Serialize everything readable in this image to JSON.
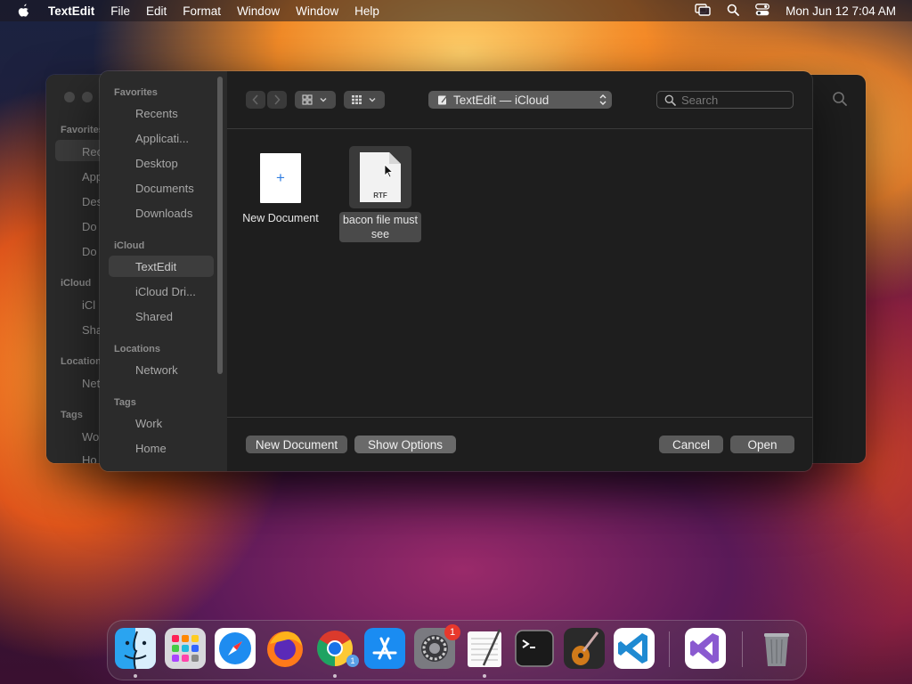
{
  "menubar": {
    "app_name": "TextEdit",
    "items": [
      "File",
      "Edit",
      "Format",
      "Window",
      "Help"
    ],
    "window_item": "Window",
    "clock": "Mon Jun 12  7:04 AM"
  },
  "bg_window": {
    "sections": [
      "Favorites",
      "iCloud",
      "Location",
      "Tags"
    ],
    "items": [
      "Rec",
      "App",
      "Des",
      "Do",
      "Do",
      "iCl",
      "Sha",
      "Net",
      "Wo",
      "Ho"
    ]
  },
  "sidebar": {
    "favorites_header": "Favorites",
    "favorites": [
      "Recents",
      "Applicati...",
      "Desktop",
      "Documents",
      "Downloads"
    ],
    "icloud_header": "iCloud",
    "icloud": [
      "TextEdit",
      "iCloud Dri...",
      "Shared"
    ],
    "locations_header": "Locations",
    "locations": [
      "Network"
    ],
    "tags_header": "Tags",
    "tags": [
      "Work",
      "Home"
    ]
  },
  "toolbar": {
    "location": "TextEdit — iCloud",
    "search_placeholder": "Search"
  },
  "files": [
    {
      "name": "New Document",
      "kind": "new"
    },
    {
      "name": "bacon file must see",
      "kind": "RTF",
      "selected": true
    }
  ],
  "file_badge": "RTF",
  "footer": {
    "new_document": "New Document",
    "show_options": "Show Options",
    "cancel": "Cancel",
    "open": "Open"
  },
  "dock": {
    "apps": [
      "Finder",
      "Launchpad",
      "Safari",
      "Firefox",
      "Chrome",
      "App Store",
      "System Settings",
      "TextEdit",
      "Terminal",
      "GarageBand",
      "VS Code",
      "Visual Studio",
      "Trash"
    ],
    "settings_badge": "1",
    "chrome_badge": "1"
  },
  "colors": {
    "accent": "#2f7de1",
    "dialog_bg": "#1e1e1e",
    "sidebar_bg": "#2b2b2b"
  }
}
